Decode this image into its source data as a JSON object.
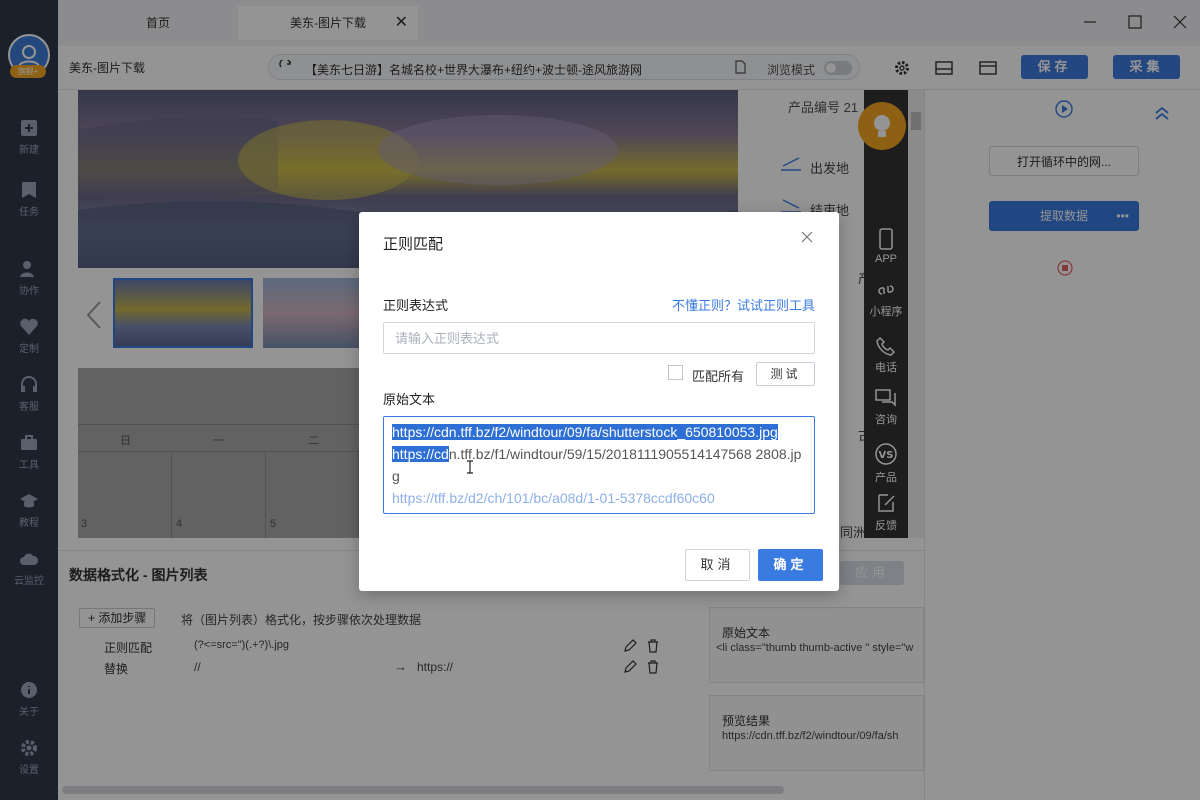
{
  "sidebar": {
    "items": [
      {
        "label": "新建",
        "icon": "plus-square-icon"
      },
      {
        "label": "任务",
        "icon": "bookmark-icon"
      },
      {
        "label": "协作",
        "icon": "users-icon"
      },
      {
        "label": "定制",
        "icon": "heart-check-icon"
      },
      {
        "label": "客服",
        "icon": "headset-icon"
      },
      {
        "label": "工具",
        "icon": "toolbox-icon"
      },
      {
        "label": "教程",
        "icon": "graduation-cap-icon"
      },
      {
        "label": "云监控",
        "icon": "cloud-icon"
      },
      {
        "label": "关于",
        "icon": "info-icon"
      },
      {
        "label": "设置",
        "icon": "gear-icon"
      }
    ],
    "badge": "旗舰+"
  },
  "tabs": [
    {
      "label": "首页"
    },
    {
      "label": "美东-图片下载"
    }
  ],
  "toolbar": {
    "title": "美东-图片下载",
    "url": "【美东七日游】名城名校+世界大瀑布+纽约+波士顿-途风旅游网",
    "browse_mode_label": "浏览模式",
    "save_label": "保存",
    "collect_label": "采集"
  },
  "content": {
    "product_id": "产品编号 21",
    "depart_label": "出发地",
    "end_label": "结束地",
    "calendar_head": [
      "日",
      "一",
      "二"
    ],
    "calendar_nums": [
      "3",
      "4",
      "5"
    ],
    "side_text_1": "产",
    "side_text_2": "古",
    "side_text_3": "同洲"
  },
  "strip": {
    "items": [
      {
        "label": "APP",
        "icon": "phone-icon"
      },
      {
        "label": "小程序",
        "icon": "miniprogram-icon"
      },
      {
        "label": "电话",
        "icon": "telephone-icon"
      },
      {
        "label": "咨询",
        "icon": "chat-icon"
      },
      {
        "label": "产品",
        "icon": "vs-icon"
      },
      {
        "label": "反馈",
        "icon": "edit-icon"
      }
    ]
  },
  "flow": {
    "node1": "打开循环中的网...",
    "node2": "提取数据",
    "node2_more": "•••"
  },
  "bottom": {
    "title": "数据格式化 - 图片列表",
    "apply_label": "应用",
    "add_step_label": "+ 添加步骤",
    "step_desc": "将（图片列表）格式化，按步骤依次处理数据",
    "steps": [
      {
        "name": "正则匹配",
        "value": "(?<=src=\")(.+?)\\.jpg",
        "target": ""
      },
      {
        "name": "替换",
        "value": "//",
        "arrow": "→",
        "target": "https://"
      }
    ],
    "original_label": "原始文本",
    "original_value": "<li class=\"thumb thumb-active \" style=\"w",
    "preview_label": "预览结果",
    "preview_value": "https://cdn.tff.bz/f2/windtour/09/fa/sh"
  },
  "modal": {
    "title": "正则匹配",
    "regex_label": "正则表达式",
    "help_link": "不懂正则？试试正则工具",
    "regex_placeholder": "请输入正则表达式",
    "match_all_label": "匹配所有",
    "test_label": "测试",
    "source_label": "原始文本",
    "line1a": "https://cdn.tff.bz/f2/windtour/09/fa/shutterstock_650810053.jpg",
    "line2a": "https://cd",
    "line2b": "n.tff.bz/f1/windtour/59/15/2018111905514147568 2808.jpg",
    "line3": "https://tff.bz/d2/ch/101/bc/a08d/1-01-5378ccdf60c60",
    "cancel_label": "取消",
    "ok_label": "确定"
  },
  "colors": {
    "sidebar_bg": "#2d3a4b",
    "accent": "#3a7be2",
    "orange": "#f5a623"
  }
}
